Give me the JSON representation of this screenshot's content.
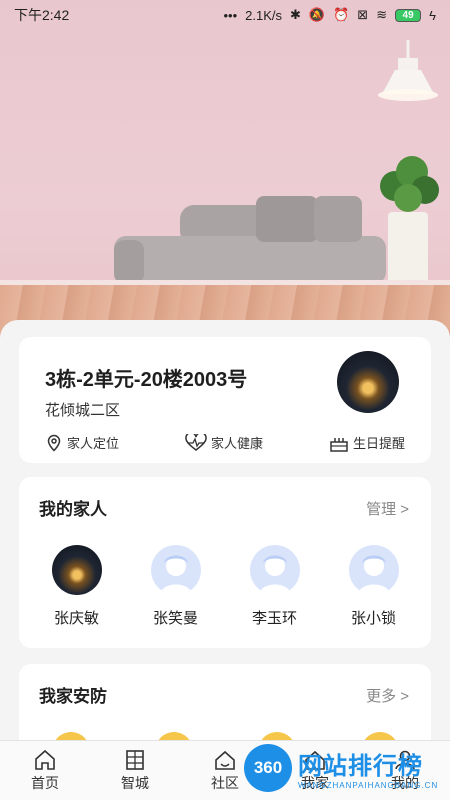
{
  "status_bar": {
    "time": "下午2:42",
    "network_speed": "2.1K/s",
    "battery": "49"
  },
  "home_card": {
    "address": "3栋-2单元-20楼2003号",
    "community": "花倾城二区",
    "actions": [
      {
        "label": "家人定位",
        "icon": "location-pin-icon"
      },
      {
        "label": "家人健康",
        "icon": "heart-pulse-icon"
      },
      {
        "label": "生日提醒",
        "icon": "birthday-cake-icon"
      }
    ]
  },
  "family": {
    "title": "我的家人",
    "link": "管理 >",
    "members": [
      {
        "name": "张庆敏",
        "avatar": "photo"
      },
      {
        "name": "张笑曼",
        "avatar": "default"
      },
      {
        "name": "李玉环",
        "avatar": "default"
      },
      {
        "name": "张小锁",
        "avatar": "default"
      }
    ]
  },
  "security": {
    "title": "我家安防",
    "link": "更多 >"
  },
  "tabbar": {
    "items": [
      {
        "label": "首页",
        "icon": "home-icon"
      },
      {
        "label": "智城",
        "icon": "building-icon"
      },
      {
        "label": "社区",
        "icon": "community-icon"
      },
      {
        "label": "我家",
        "icon": "my-home-icon"
      },
      {
        "label": "我的",
        "icon": "profile-icon"
      }
    ]
  },
  "watermark": {
    "logo": "360",
    "text": "网站排行榜",
    "subtext": "WANGZHANPAIHANGBANG.CN"
  },
  "colors": {
    "accent_blue": "#1e8fe6",
    "security_yellow": "#f5c64a",
    "avatar_placeholder": "#d9e4fb"
  }
}
